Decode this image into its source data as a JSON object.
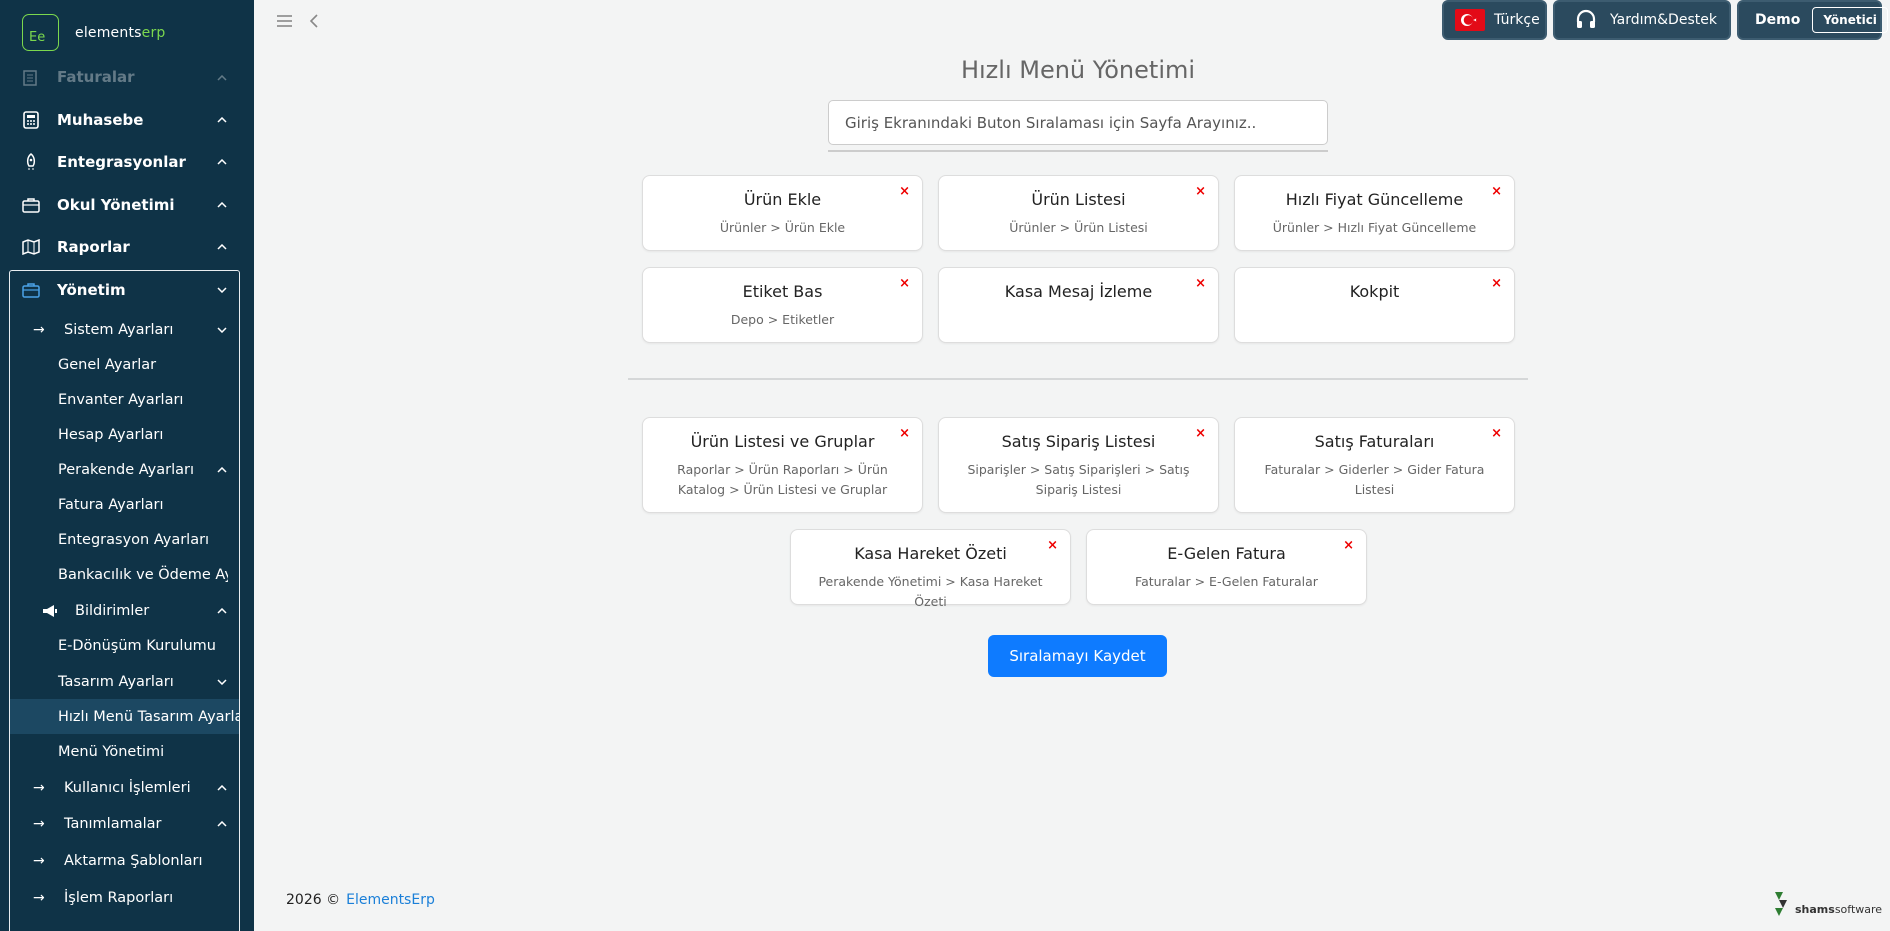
{
  "brand": {
    "logo_mark": "Ee",
    "name_a": "elements",
    "name_b": "erp"
  },
  "sidebar": {
    "faded": "Faturalar",
    "items": [
      {
        "label": "Muhasebe",
        "icon": "calculator-icon"
      },
      {
        "label": "Entegrasyonlar",
        "icon": "rocket-icon"
      },
      {
        "label": "Okul Yönetimi",
        "icon": "briefcase-icon"
      },
      {
        "label": "Raporlar",
        "icon": "map-icon"
      },
      {
        "label": "Yönetim",
        "icon": "briefcase-icon"
      }
    ],
    "sub": [
      {
        "label": "Sistem Ayarları"
      },
      {
        "label": "Genel Ayarlar"
      },
      {
        "label": "Envanter Ayarları"
      },
      {
        "label": "Hesap Ayarları"
      },
      {
        "label": "Perakende Ayarları"
      },
      {
        "label": "Fatura Ayarları"
      },
      {
        "label": "Entegrasyon Ayarları"
      },
      {
        "label": "Bankacılık ve Ödeme Ayarları"
      },
      {
        "label": "Bildirimler"
      },
      {
        "label": "E-Dönüşüm Kurulumu"
      },
      {
        "label": "Tasarım Ayarları"
      },
      {
        "label": "Hızlı Menü Tasarım Ayarları"
      },
      {
        "label": "Menü Yönetimi"
      },
      {
        "label": "Kullanıcı İşlemleri"
      },
      {
        "label": "Tanımlamalar"
      },
      {
        "label": "Aktarma Şablonları"
      },
      {
        "label": "İşlem Raporları"
      }
    ]
  },
  "topbar": {
    "language": "Türkçe",
    "support": "Yardım&Destek",
    "user": "Demo",
    "role": "Yönetici"
  },
  "page": {
    "title": "Hızlı Menü Yönetimi",
    "search_placeholder": "Giriş Ekranındaki Buton Sıralaması için Sayfa Arayınız.."
  },
  "cards_top": [
    {
      "title": "Ürün Ekle",
      "path": "Ürünler > Ürün Ekle"
    },
    {
      "title": "Ürün Listesi",
      "path": "Ürünler > Ürün Listesi"
    },
    {
      "title": "Hızlı Fiyat Güncelleme",
      "path": "Ürünler > Hızlı Fiyat Güncelleme"
    },
    {
      "title": "Etiket Bas",
      "path": "Depo > Etiketler"
    },
    {
      "title": "Kasa Mesaj İzleme",
      "path": ""
    },
    {
      "title": "Kokpit",
      "path": ""
    }
  ],
  "cards_bottom": [
    {
      "title": "Ürün Listesi ve Gruplar",
      "path": "Raporlar > Ürün Raporları > Ürün Katalog > Ürün Listesi ve Gruplar"
    },
    {
      "title": "Satış Sipariş Listesi",
      "path": "Siparişler > Satış Siparişleri > Satış Sipariş Listesi"
    },
    {
      "title": "Satış Faturaları",
      "path": "Faturalar > Giderler > Gider Fatura Listesi"
    },
    {
      "title": "Kasa Hareket Özeti",
      "path": "Perakende Yönetimi > Kasa Hareket Özeti"
    },
    {
      "title": "E-Gelen Fatura",
      "path": "Faturalar > E-Gelen Faturalar"
    }
  ],
  "remove_glyph": "×",
  "save_label": "Sıralamayı Kaydet",
  "footer": {
    "year": "2026 ©",
    "link": "ElementsErp"
  },
  "vendor": {
    "a": "shams",
    "b": "software"
  }
}
